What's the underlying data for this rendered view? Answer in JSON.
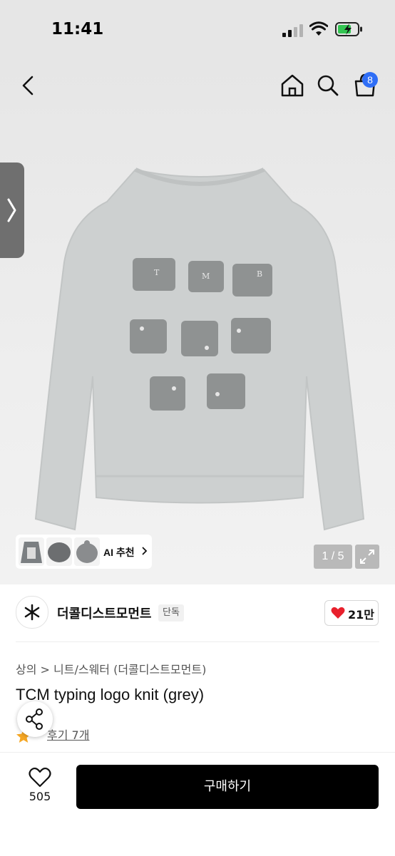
{
  "status": {
    "time": "11:41"
  },
  "header": {
    "cart_count": "8"
  },
  "gallery": {
    "ai_label": "AI 추천",
    "page_indicator": "1 / 5",
    "thumbnails": [
      "thumbnail-1",
      "thumbnail-2",
      "thumbnail-3"
    ]
  },
  "brand": {
    "name": "더콜디스트모먼트",
    "badge": "단독",
    "likes": "21만"
  },
  "product": {
    "breadcrumb": "상의 > 니트/스웨터 (더콜디스트모먼트)",
    "title": "TCM typing logo knit (grey)",
    "rating": "5",
    "reviews": "후기 7개"
  },
  "bottom": {
    "wishlist_count": "505",
    "buy_label": "구매하기"
  },
  "colors": {
    "accent": "#2f6ef6",
    "like": "#e8202c",
    "buy_button": "#000000",
    "star": "#f5a623"
  }
}
